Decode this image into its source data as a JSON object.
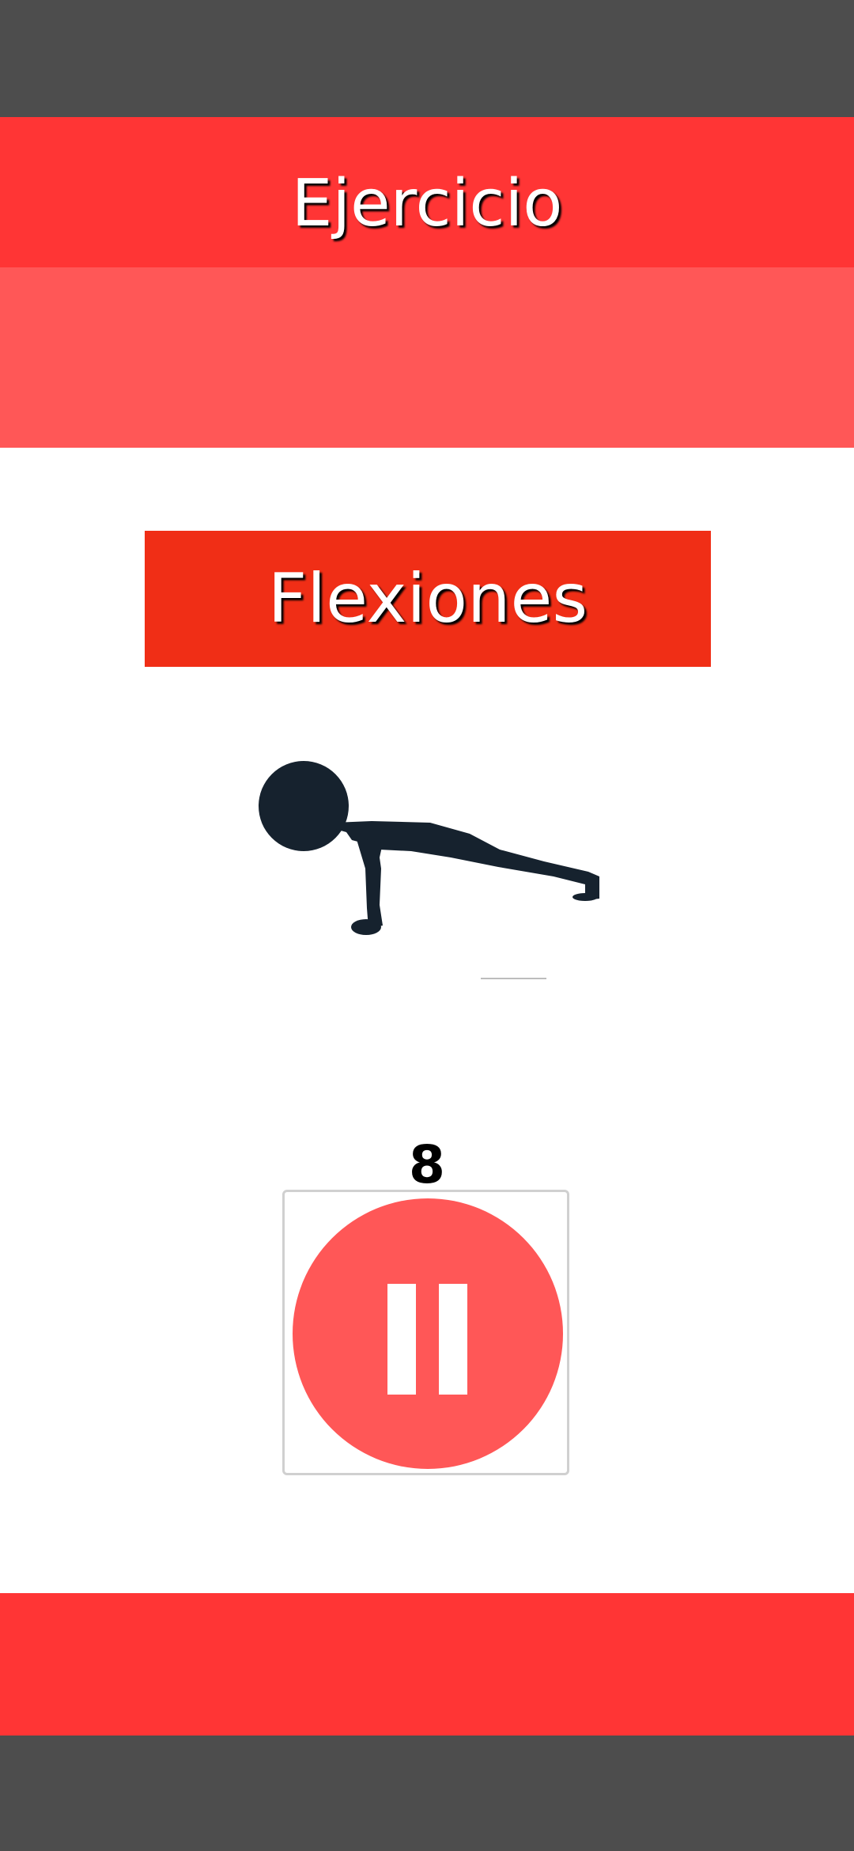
{
  "header": {
    "title": "Ejercicio"
  },
  "exercise": {
    "name": "Flexiones",
    "illustration": "pushup-figure"
  },
  "timer": {
    "remaining": "8"
  },
  "controls": {
    "pause_icon": "pause-icon"
  },
  "colors": {
    "header_red": "#ff3535",
    "band_red": "#ff5757",
    "banner_red": "#f02e16",
    "system_bar_gray": "#4d4d4d",
    "figure_dark": "#16222e"
  }
}
